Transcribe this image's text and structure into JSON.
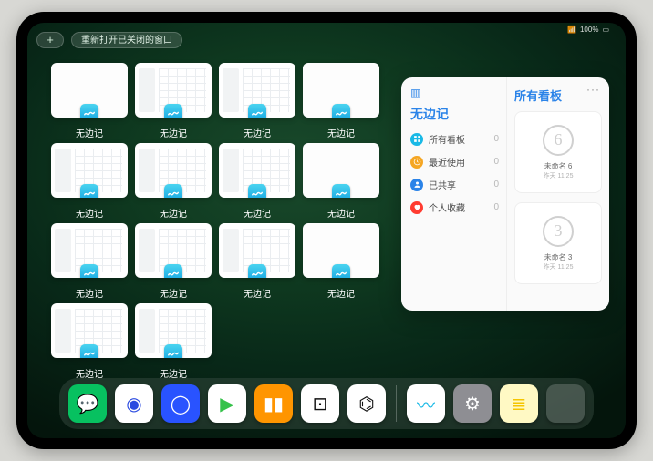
{
  "status": {
    "signal": "📶",
    "battery": "100%",
    "wifi": "🛜"
  },
  "topbar": {
    "plus": "+",
    "reopen_label": "重新打开已关闭的窗口"
  },
  "window_label": "无边记",
  "windows": [
    {
      "style": "blank"
    },
    {
      "style": "cal"
    },
    {
      "style": "cal"
    },
    {
      "style": "blank"
    },
    {
      "style": "cal"
    },
    {
      "style": "cal"
    },
    {
      "style": "cal"
    },
    {
      "style": "blank"
    },
    {
      "style": "cal"
    },
    {
      "style": "cal"
    },
    {
      "style": "cal"
    },
    {
      "style": "blank"
    },
    {
      "style": "cal"
    },
    {
      "style": "cal"
    }
  ],
  "panel": {
    "left_title": "无边记",
    "right_title": "所有看板",
    "ellipsis": "···",
    "categories": [
      {
        "label": "所有看板",
        "count": 0,
        "color": "#19b9e6",
        "icon": "grid"
      },
      {
        "label": "最近使用",
        "count": 0,
        "color": "#f5a623",
        "icon": "clock"
      },
      {
        "label": "已共享",
        "count": 0,
        "color": "#2a83e8",
        "icon": "person"
      },
      {
        "label": "个人收藏",
        "count": 0,
        "color": "#ff3b30",
        "icon": "heart"
      }
    ],
    "boards": [
      {
        "scribble": "6",
        "title": "未命名 6",
        "sub": "昨天 11:25"
      },
      {
        "scribble": "3",
        "title": "未命名 3",
        "sub": "昨天 11:25"
      }
    ]
  },
  "dock": {
    "apps": [
      {
        "name": "wechat",
        "bg": "#07c160",
        "glyph": "💬"
      },
      {
        "name": "quark-hd",
        "bg": "#ffffff",
        "glyph": "◉",
        "fg": "#2a4ae0"
      },
      {
        "name": "quark",
        "bg": "#2953ff",
        "glyph": "◯"
      },
      {
        "name": "play",
        "bg": "#ffffff",
        "glyph": "▶",
        "fg": "#35c24a"
      },
      {
        "name": "books",
        "bg": "#ff9500",
        "glyph": "▮▮",
        "fg": "#fff"
      },
      {
        "name": "dice",
        "bg": "#ffffff",
        "glyph": "⊡",
        "fg": "#111"
      },
      {
        "name": "graph",
        "bg": "#ffffff",
        "glyph": "⌬",
        "fg": "#111"
      }
    ],
    "recent": [
      {
        "name": "freeform",
        "bg": "#ffffff",
        "glyph": "〰",
        "fg": "#19b9e6"
      },
      {
        "name": "settings",
        "bg": "#8e8e93",
        "glyph": "⚙"
      },
      {
        "name": "notes",
        "bg": "#fff9c4",
        "glyph": "≣",
        "fg": "#f5c500"
      }
    ]
  }
}
